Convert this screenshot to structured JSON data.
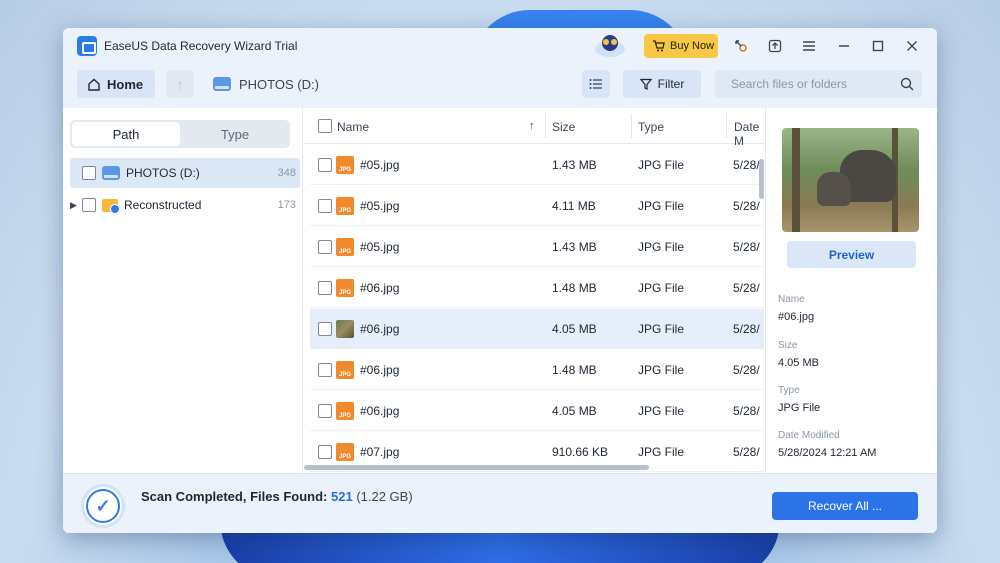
{
  "window": {
    "title": "EaseUS Data Recovery Wizard Trial",
    "buy_label": "Buy Now",
    "accent": "#2b73e6",
    "buy_color": "#f7c846"
  },
  "toolbar": {
    "home_label": "Home",
    "location_label": "PHOTOS (D:)",
    "filter_label": "Filter",
    "search_placeholder": "Search files or folders"
  },
  "left_pane": {
    "tabs": [
      "Path",
      "Type"
    ],
    "tree": [
      {
        "label": "PHOTOS (D:)",
        "count": "348"
      },
      {
        "label": "Reconstructed",
        "count": "173"
      }
    ]
  },
  "file_table": {
    "columns": [
      "Name",
      "Size",
      "Type",
      "Date M"
    ],
    "rows": [
      {
        "name": "#05.jpg",
        "size": "1.43 MB",
        "type": "JPG File",
        "date": "5/28/"
      },
      {
        "name": "#05.jpg",
        "size": "4.11 MB",
        "type": "JPG File",
        "date": "5/28/"
      },
      {
        "name": "#05.jpg",
        "size": "1.43 MB",
        "type": "JPG File",
        "date": "5/28/"
      },
      {
        "name": "#06.jpg",
        "size": "1.48 MB",
        "type": "JPG File",
        "date": "5/28/"
      },
      {
        "name": "#06.jpg",
        "size": "4.05 MB",
        "type": "JPG File",
        "date": "5/28/"
      },
      {
        "name": "#06.jpg",
        "size": "1.48 MB",
        "type": "JPG File",
        "date": "5/28/"
      },
      {
        "name": "#06.jpg",
        "size": "4.05 MB",
        "type": "JPG File",
        "date": "5/28/"
      },
      {
        "name": "#07.jpg",
        "size": "910.66 KB",
        "type": "JPG File",
        "date": "5/28/"
      }
    ],
    "file_icon_text": "JPG"
  },
  "details": {
    "preview_label": "Preview",
    "name_label": "Name",
    "name_value": "#06.jpg",
    "size_label": "Size",
    "size_value": "4.05 MB",
    "type_label": "Type",
    "type_value": "JPG File",
    "date_label": "Date Modified",
    "date_value": "5/28/2024 12:21 AM"
  },
  "footer": {
    "status_prefix": "Scan Completed, Files Found:",
    "files_found": "521",
    "total_size": "(1.22 GB)",
    "recover_label": "Recover All ..."
  }
}
